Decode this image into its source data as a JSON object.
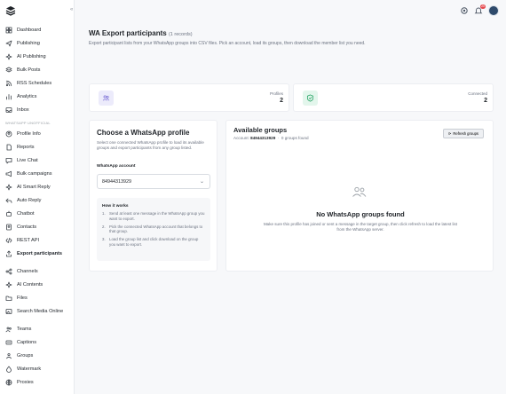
{
  "colors": {
    "accent": "#7c6fd6",
    "success": "#1a9e5c",
    "text": "#1f2328",
    "muted": "#6b7280",
    "badge": "#e5484d"
  },
  "sidebar": {
    "groups": [
      {
        "section": "",
        "items": [
          {
            "label": "Dashboard",
            "icon": "dashboard-icon"
          },
          {
            "label": "Publishing",
            "icon": "send-icon"
          },
          {
            "label": "AI Publishing",
            "icon": "sparkle-icon"
          },
          {
            "label": "Bulk Posts",
            "icon": "layers-icon"
          },
          {
            "label": "RSS Schedules",
            "icon": "rss-icon"
          },
          {
            "label": "Analytics",
            "icon": "chart-icon"
          },
          {
            "label": "Inbox",
            "icon": "inbox-icon"
          }
        ]
      },
      {
        "section": "WHATSAPP UNOFFICIAL",
        "items": [
          {
            "label": "Profile Info",
            "icon": "user-circle-icon"
          },
          {
            "label": "Reports",
            "icon": "file-icon"
          },
          {
            "label": "Live Chat",
            "icon": "chat-icon"
          },
          {
            "label": "Bulk campaigns",
            "icon": "megaphone-icon"
          },
          {
            "label": "AI Smart Reply",
            "icon": "sparkle-icon"
          },
          {
            "label": "Auto Reply",
            "icon": "reply-icon"
          },
          {
            "label": "Chatbot",
            "icon": "bot-icon"
          },
          {
            "label": "Contacts",
            "icon": "contacts-icon"
          },
          {
            "label": "REST API",
            "icon": "code-icon"
          },
          {
            "label": "Export participants",
            "icon": "export-icon",
            "active": true
          }
        ]
      },
      {
        "section": "",
        "items": [
          {
            "label": "Channels",
            "icon": "share-icon"
          },
          {
            "label": "AI Contents",
            "icon": "sparkle-icon"
          },
          {
            "label": "Files",
            "icon": "folder-icon"
          },
          {
            "label": "Search Media Online",
            "icon": "image-search-icon"
          }
        ]
      },
      {
        "section": "",
        "items": [
          {
            "label": "Teams",
            "icon": "team-icon"
          },
          {
            "label": "Captions",
            "icon": "caption-icon"
          },
          {
            "label": "Groups",
            "icon": "group-icon"
          },
          {
            "label": "Watermark",
            "icon": "watermark-icon"
          },
          {
            "label": "Proxies",
            "icon": "globe-icon"
          }
        ]
      }
    ]
  },
  "topbar": {
    "notification_count": "20"
  },
  "page": {
    "title": "WA Export participants",
    "count_label": "(1 records)",
    "description": "Export participant lists from your WhatsApp groups into CSV files. Pick an account, load its groups, then download the member list you need."
  },
  "stats": [
    {
      "label": "Profiles",
      "value": "2",
      "icon": "users-icon",
      "bg": "#ecebfb",
      "fg": "#7c6fd6"
    },
    {
      "label": "Connected",
      "value": "2",
      "icon": "check-shield-icon",
      "bg": "#e3f6ec",
      "fg": "#1a9e5c"
    }
  ],
  "left_card": {
    "title": "Choose a WhatsApp profile",
    "description": "Select one connected WhatsApp profile to load its available groups and export participants from any group listed.",
    "field_label": "WhatsApp account",
    "selected_account": "84944313929",
    "how_title": "How it works",
    "steps": [
      {
        "n": "1.",
        "text": "Send at least one message in the WhatsApp group you want to export."
      },
      {
        "n": "2.",
        "text": "Pick the connected WhatsApp account that belongs to that group."
      },
      {
        "n": "3.",
        "text": "Load the group list and click download on the group you want to export."
      }
    ]
  },
  "right_card": {
    "title": "Available groups",
    "account_prefix": "Account:",
    "account_number": "84944313929",
    "groups_found": "0 groups found",
    "refresh_label": "Refresh groups",
    "empty_title": "No WhatsApp groups found",
    "empty_description": "Make sure this profile has joined or sent a message in the target group, then click refresh to load the latest list from the WhatsApp server."
  }
}
